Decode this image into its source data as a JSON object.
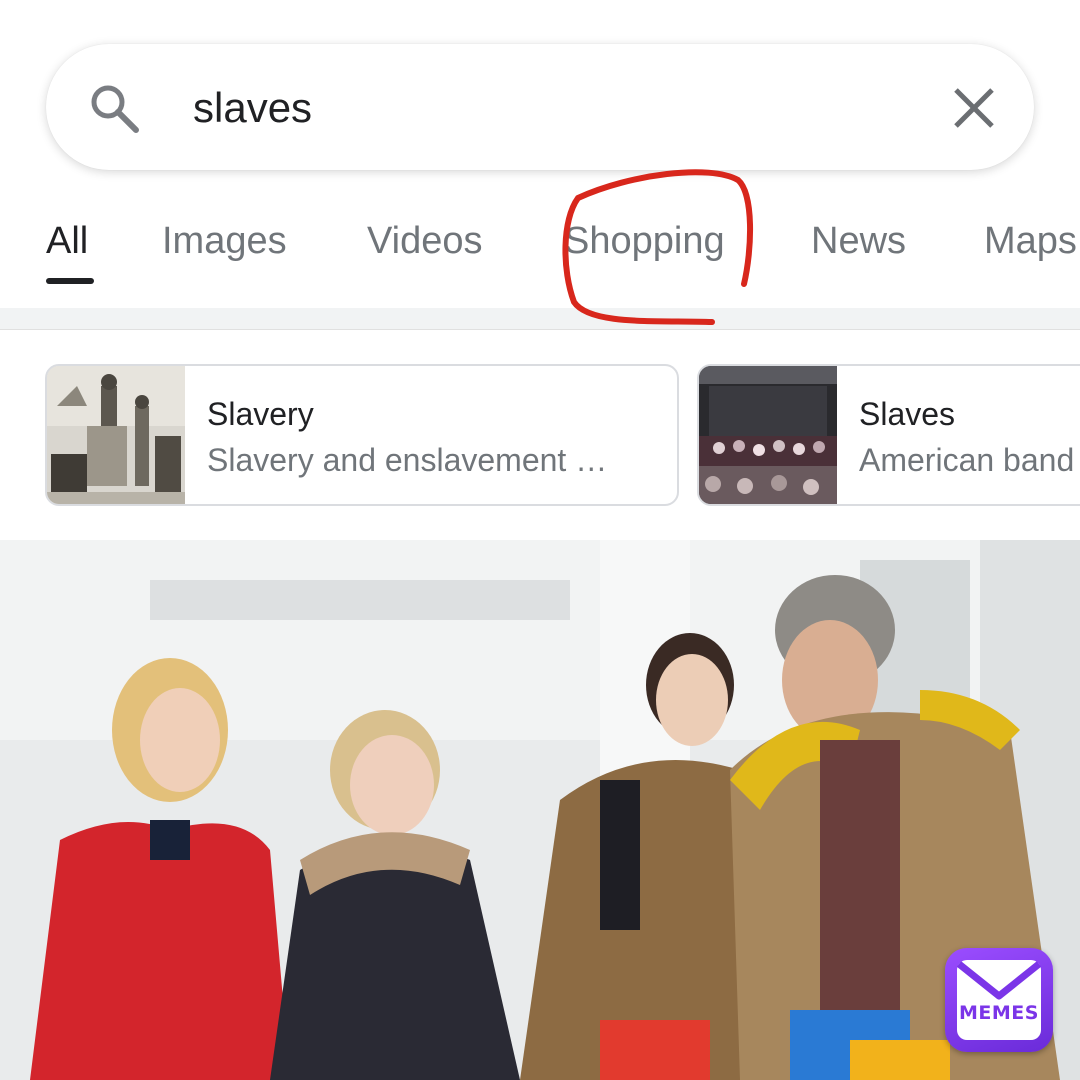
{
  "search": {
    "query": "slaves"
  },
  "tabs": [
    {
      "label": "All",
      "active": true
    },
    {
      "label": "Images",
      "active": false
    },
    {
      "label": "Videos",
      "active": false
    },
    {
      "label": "Shopping",
      "active": false
    },
    {
      "label": "News",
      "active": false
    },
    {
      "label": "Maps",
      "active": false
    }
  ],
  "cards": [
    {
      "title": "Slavery",
      "subtitle": "Slavery and enslavement …"
    },
    {
      "title": "Slaves",
      "subtitle": "American band"
    }
  ],
  "watermark": {
    "text": "MEMES",
    "color": "#7b35e8"
  },
  "colors": {
    "annotation": "#d8271c",
    "active_tab": "#202124",
    "inactive_tab": "#70757a"
  }
}
